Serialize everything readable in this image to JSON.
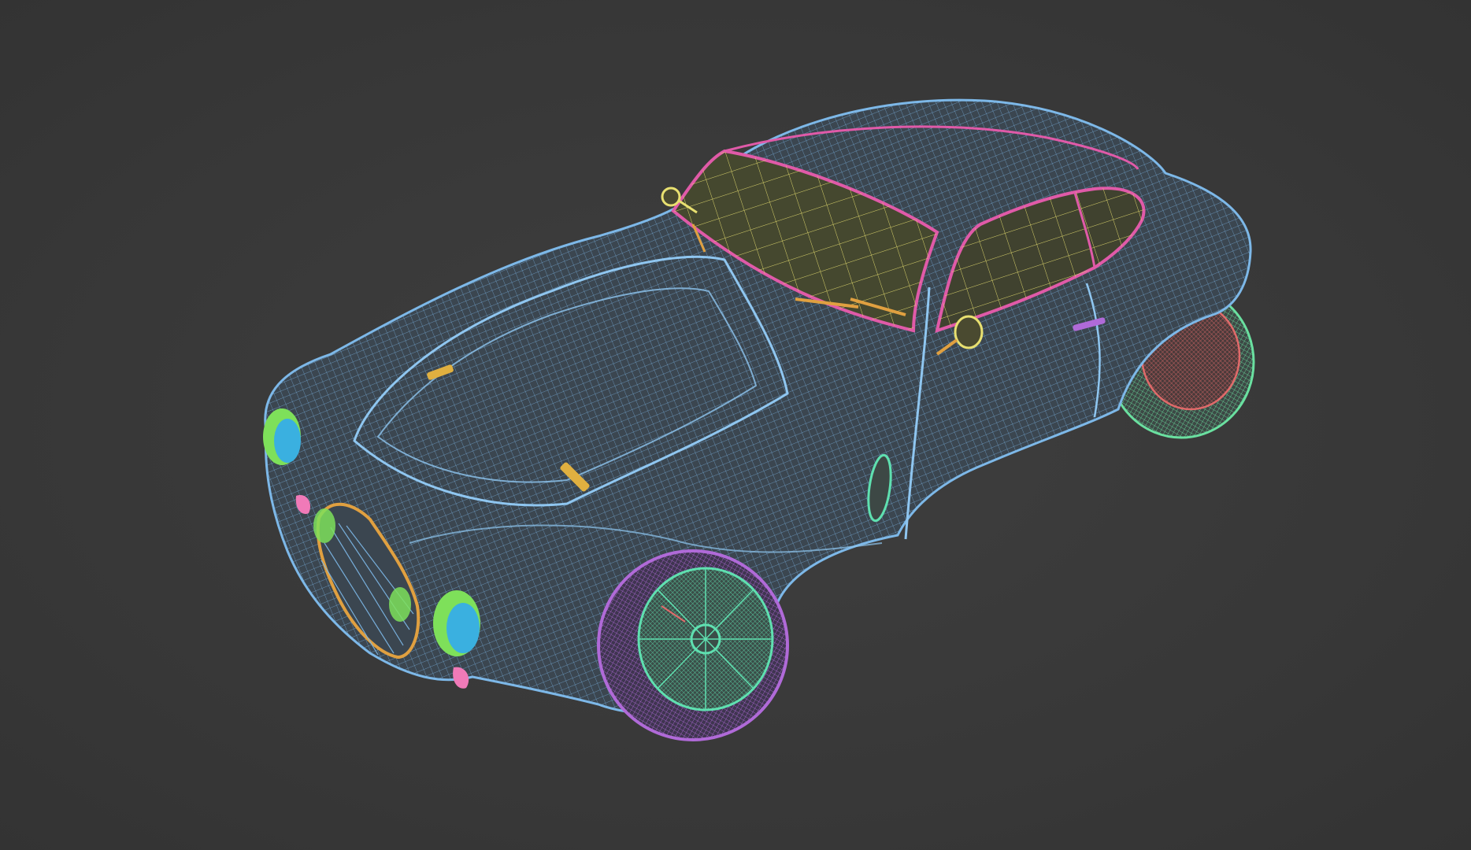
{
  "scene": {
    "background": "#3a3a3a",
    "view_mode": "wireframe",
    "subject": "classic-coupe"
  },
  "colors": {
    "body_wire": "#7db8e8",
    "body_fill": "#3b4650",
    "glass_wire": "#e8e070",
    "trim_magenta": "#e05aa8",
    "tire_purple": "#b06ad8",
    "wheel_teal": "#5fe0b0",
    "wheel_rear_red": "#e06a6a",
    "headlight_green": "#7ee05a",
    "headlight_cyan": "#3ab0e0",
    "grille_orange": "#e0a040",
    "mirror_yellow": "#e8e070",
    "bumper_pink": "#f07ab8",
    "tire_rear_green": "#6ae0a0"
  },
  "components": [
    "body-shell",
    "windshield",
    "side-window",
    "front-left-wheel",
    "rear-left-wheel",
    "left-headlight",
    "right-headlight",
    "grille",
    "hood-latch-front",
    "hood-latch-rear",
    "side-mirror-left",
    "side-mirror-right",
    "side-vent",
    "door-handle",
    "wipers"
  ]
}
